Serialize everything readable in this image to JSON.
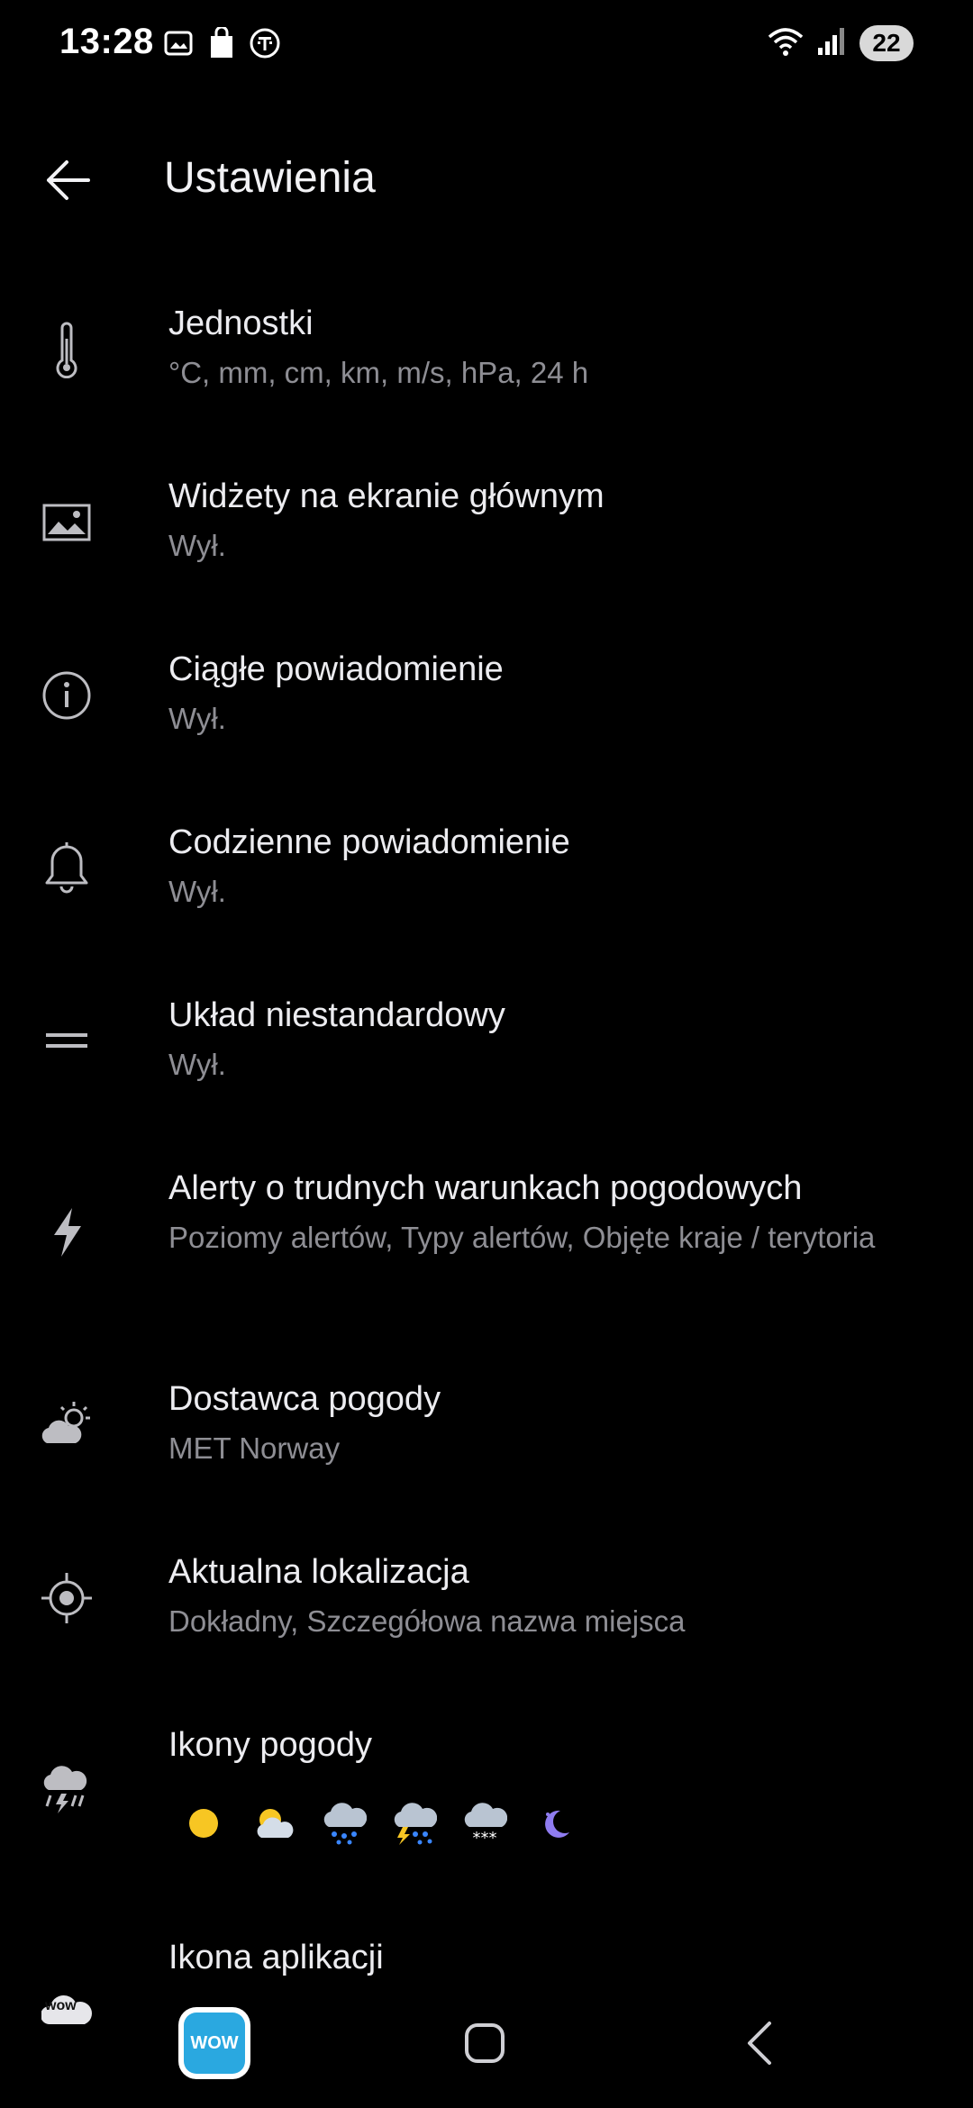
{
  "status_bar": {
    "time": "13:28",
    "battery": "22"
  },
  "app_bar": {
    "title": "Ustawienia"
  },
  "settings": {
    "units": {
      "title": "Jednostki",
      "subtitle": "°C, mm, cm, km, m/s, hPa, 24 h"
    },
    "widgets": {
      "title": "Widżety na ekranie głównym",
      "subtitle": "Wył."
    },
    "persistent_notification": {
      "title": "Ciągłe powiadomienie",
      "subtitle": "Wył."
    },
    "daily_notification": {
      "title": "Codzienne powiadomienie",
      "subtitle": "Wył."
    },
    "custom_layout": {
      "title": "Układ niestandardowy",
      "subtitle": "Wył."
    },
    "severe_alerts": {
      "title": "Alerty o trudnych warunkach pogodowych",
      "subtitle": "Poziomy alertów, Typy alertów, Objęte kraje / terytoria"
    },
    "weather_provider": {
      "title": "Dostawca pogody",
      "subtitle": "MET Norway"
    },
    "current_location": {
      "title": "Aktualna lokalizacja",
      "subtitle": "Dokładny, Szczegółowa nazwa miejsca"
    },
    "weather_icons": {
      "title": "Ikony pogody"
    },
    "app_icon": {
      "title": "Ikona aplikacji",
      "icon_text": "wow"
    }
  },
  "nav": {
    "app_shortcut_text": "WOW"
  },
  "colors": {
    "background": "#000000",
    "title_text": "#ececf0",
    "subtitle_text": "#8e8e94",
    "icon": "#bdbdc2"
  }
}
